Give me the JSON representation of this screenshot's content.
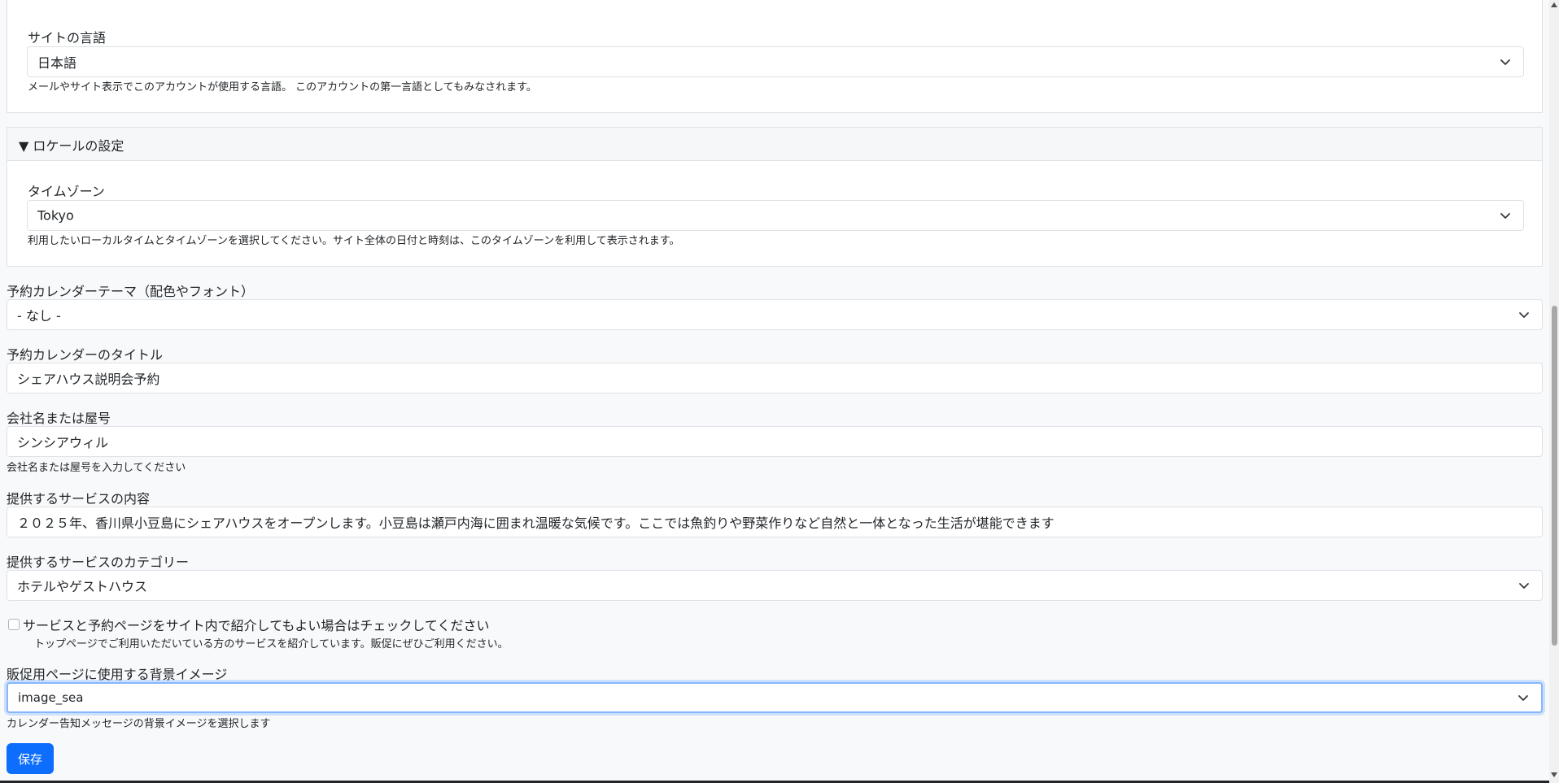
{
  "language_section": {
    "label": "サイトの言語",
    "value": "日本語",
    "help": "メールやサイト表示でこのアカウントが使用する言語。 このアカウントの第一言語としてもみなされます。"
  },
  "locale_section": {
    "legend": "▼ ロケールの設定",
    "timezone_label": "タイムゾーン",
    "timezone_value": "Tokyo",
    "timezone_help": "利用したいローカルタイムとタイムゾーンを選択してください。サイト全体の日付と時刻は、このタイムゾーンを利用して表示されます。"
  },
  "theme": {
    "label": "予約カレンダーテーマ（配色やフォント）",
    "value": "- なし -"
  },
  "calendar_title": {
    "label": "予約カレンダーのタイトル",
    "value": "シェアハウス説明会予約"
  },
  "company": {
    "label": "会社名または屋号",
    "value": "シンシアウィル",
    "help": "会社名または屋号を入力してください"
  },
  "service_content": {
    "label": "提供するサービスの内容",
    "value": "２０２５年、香川県小豆島にシェアハウスをオープンします。小豆島は瀬戸内海に囲まれ温暖な気候です。ここでは魚釣りや野菜作りなど自然と一体となった生活が堪能できます"
  },
  "service_category": {
    "label": "提供するサービスのカテゴリー",
    "value": "ホテルやゲストハウス"
  },
  "introduce": {
    "label": "サービスと予約ページをサイト内で紹介してもよい場合はチェックしてください",
    "help": "トップページでご利用いただいている方のサービスを紹介しています。販促にぜひご利用ください。",
    "checked": false
  },
  "background_image": {
    "label": "販促用ページに使用する背景イメージ",
    "value": "image_sea",
    "help": "カレンダー告知メッセージの背景イメージを選択します"
  },
  "actions": {
    "save_label": "保存"
  }
}
